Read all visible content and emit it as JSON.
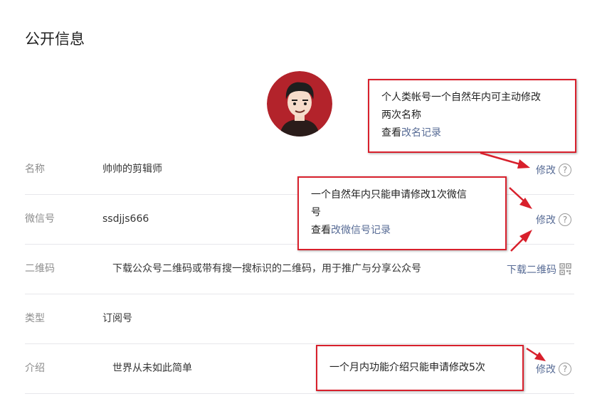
{
  "section": {
    "title": "公开信息"
  },
  "rows": [
    {
      "label": "名称",
      "value": "帅帅的剪辑师",
      "action": "修改"
    },
    {
      "label": "微信号",
      "value": "ssdjjs666",
      "action": "修改"
    },
    {
      "label": "二维码",
      "value": "下载公众号二维码或带有搜一搜标识的二维码，用于推广与分享公众号",
      "action": "下载二维码"
    },
    {
      "label": "类型",
      "value": "订阅号"
    },
    {
      "label": "介绍",
      "value": "世界从未如此简单",
      "action": "修改"
    }
  ],
  "help_glyph": "?",
  "notes": {
    "name": {
      "line1": "个人类帐号一个自然年内可主动修改",
      "line2": "两次名称",
      "prefix": "查看",
      "link": "改名记录"
    },
    "wechat": {
      "line1": "一个自然年内只能申请修改1次微信",
      "line2": "号",
      "prefix": "查看",
      "link": "改微信号记录"
    },
    "intro": {
      "line1": "一个月内功能介绍只能申请修改5次"
    }
  },
  "colors": {
    "link": "#576b95",
    "annotation_red": "#d8202c",
    "divider": "#e7e7eb",
    "label_gray": "#8d8d8d"
  },
  "icons": {
    "help": "question-circle-icon",
    "qr": "qr-code-icon"
  }
}
